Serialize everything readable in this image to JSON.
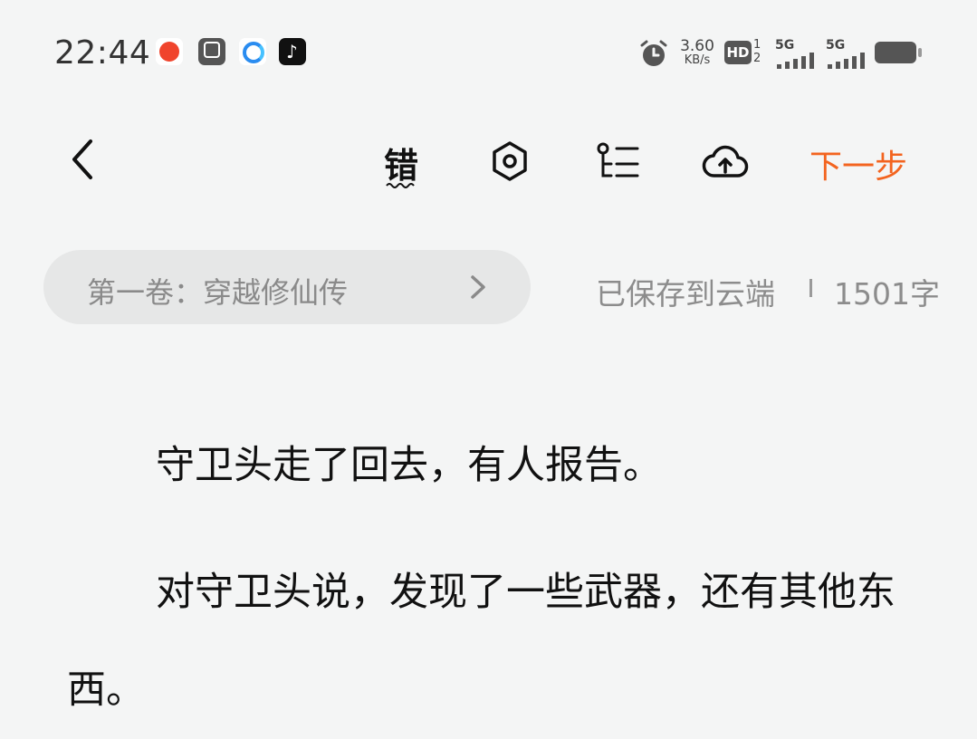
{
  "status_bar": {
    "time": "22:44",
    "net_speed_value": "3.60",
    "net_speed_unit": "KB/s",
    "hd_label": "HD",
    "hd_sim_1": "1",
    "hd_sim_2": "2",
    "sim1_label": "5G",
    "sim2_label": "5G",
    "app_icons": [
      "news-app-icon",
      "scissors-app-icon",
      "browser-app-icon",
      "tiktok-app-icon"
    ]
  },
  "toolbar": {
    "error_check_char": "错",
    "next_label": "下一步",
    "icons": [
      "back-arrow-icon",
      "typo-check-icon",
      "settings-icon",
      "outline-icon",
      "cloud-upload-icon"
    ]
  },
  "chapter_bar": {
    "volume_label": "第一卷：穿越修仙传",
    "save_status": "已保存到云端",
    "word_count": "1501字"
  },
  "editor": {
    "paragraphs": [
      "守卫头走了回去，有人报告。",
      "对守卫头说，发现了一些武器，还有其他东西。"
    ]
  },
  "colors": {
    "accent": "#f3641f",
    "background": "#f4f5f5",
    "pill": "#e6e7e7",
    "muted_text": "#8c8c8c"
  }
}
